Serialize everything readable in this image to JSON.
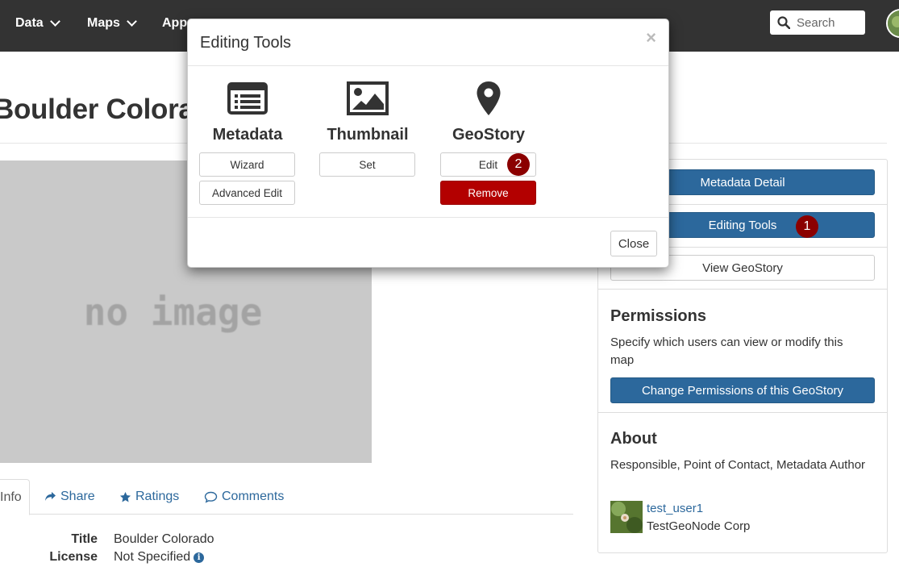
{
  "nav": {
    "items": [
      {
        "label": "Data"
      },
      {
        "label": "Maps"
      },
      {
        "label": "Apps"
      }
    ],
    "search_placeholder": "Search"
  },
  "page": {
    "title": "Boulder Colorado",
    "image_placeholder": "no image"
  },
  "tabs": [
    {
      "label": "Info"
    },
    {
      "label": "Share"
    },
    {
      "label": "Ratings"
    },
    {
      "label": "Comments"
    }
  ],
  "info": {
    "title_key": "Title",
    "title_value": "Boulder Colorado",
    "license_key": "License",
    "license_value": "Not Specified"
  },
  "sidebar": {
    "metadata_detail": "Metadata Detail",
    "editing_tools": "Editing Tools",
    "view_geostory": "View GeoStory",
    "permissions_heading": "Permissions",
    "permissions_text": "Specify which users can view or modify this map",
    "change_permissions": "Change Permissions of this GeoStory",
    "about_heading": "About",
    "about_roles": "Responsible, Point of Contact, Metadata Author",
    "user_name": "test_user1",
    "user_org": "TestGeoNode Corp"
  },
  "badges": {
    "first": "1",
    "second": "2"
  },
  "modal": {
    "title": "Editing Tools",
    "close_x": "×",
    "metadata": {
      "label": "Metadata",
      "wizard": "Wizard",
      "advanced": "Advanced Edit"
    },
    "thumbnail": {
      "label": "Thumbnail",
      "set": "Set"
    },
    "geostory": {
      "label": "GeoStory",
      "edit": "Edit",
      "remove": "Remove"
    },
    "close_button": "Close"
  },
  "colors": {
    "navbar": "#333333",
    "primary": "#2c689c",
    "danger": "#b30000",
    "badge": "#8b0000",
    "no_image_bg": "#c9c9c9"
  }
}
